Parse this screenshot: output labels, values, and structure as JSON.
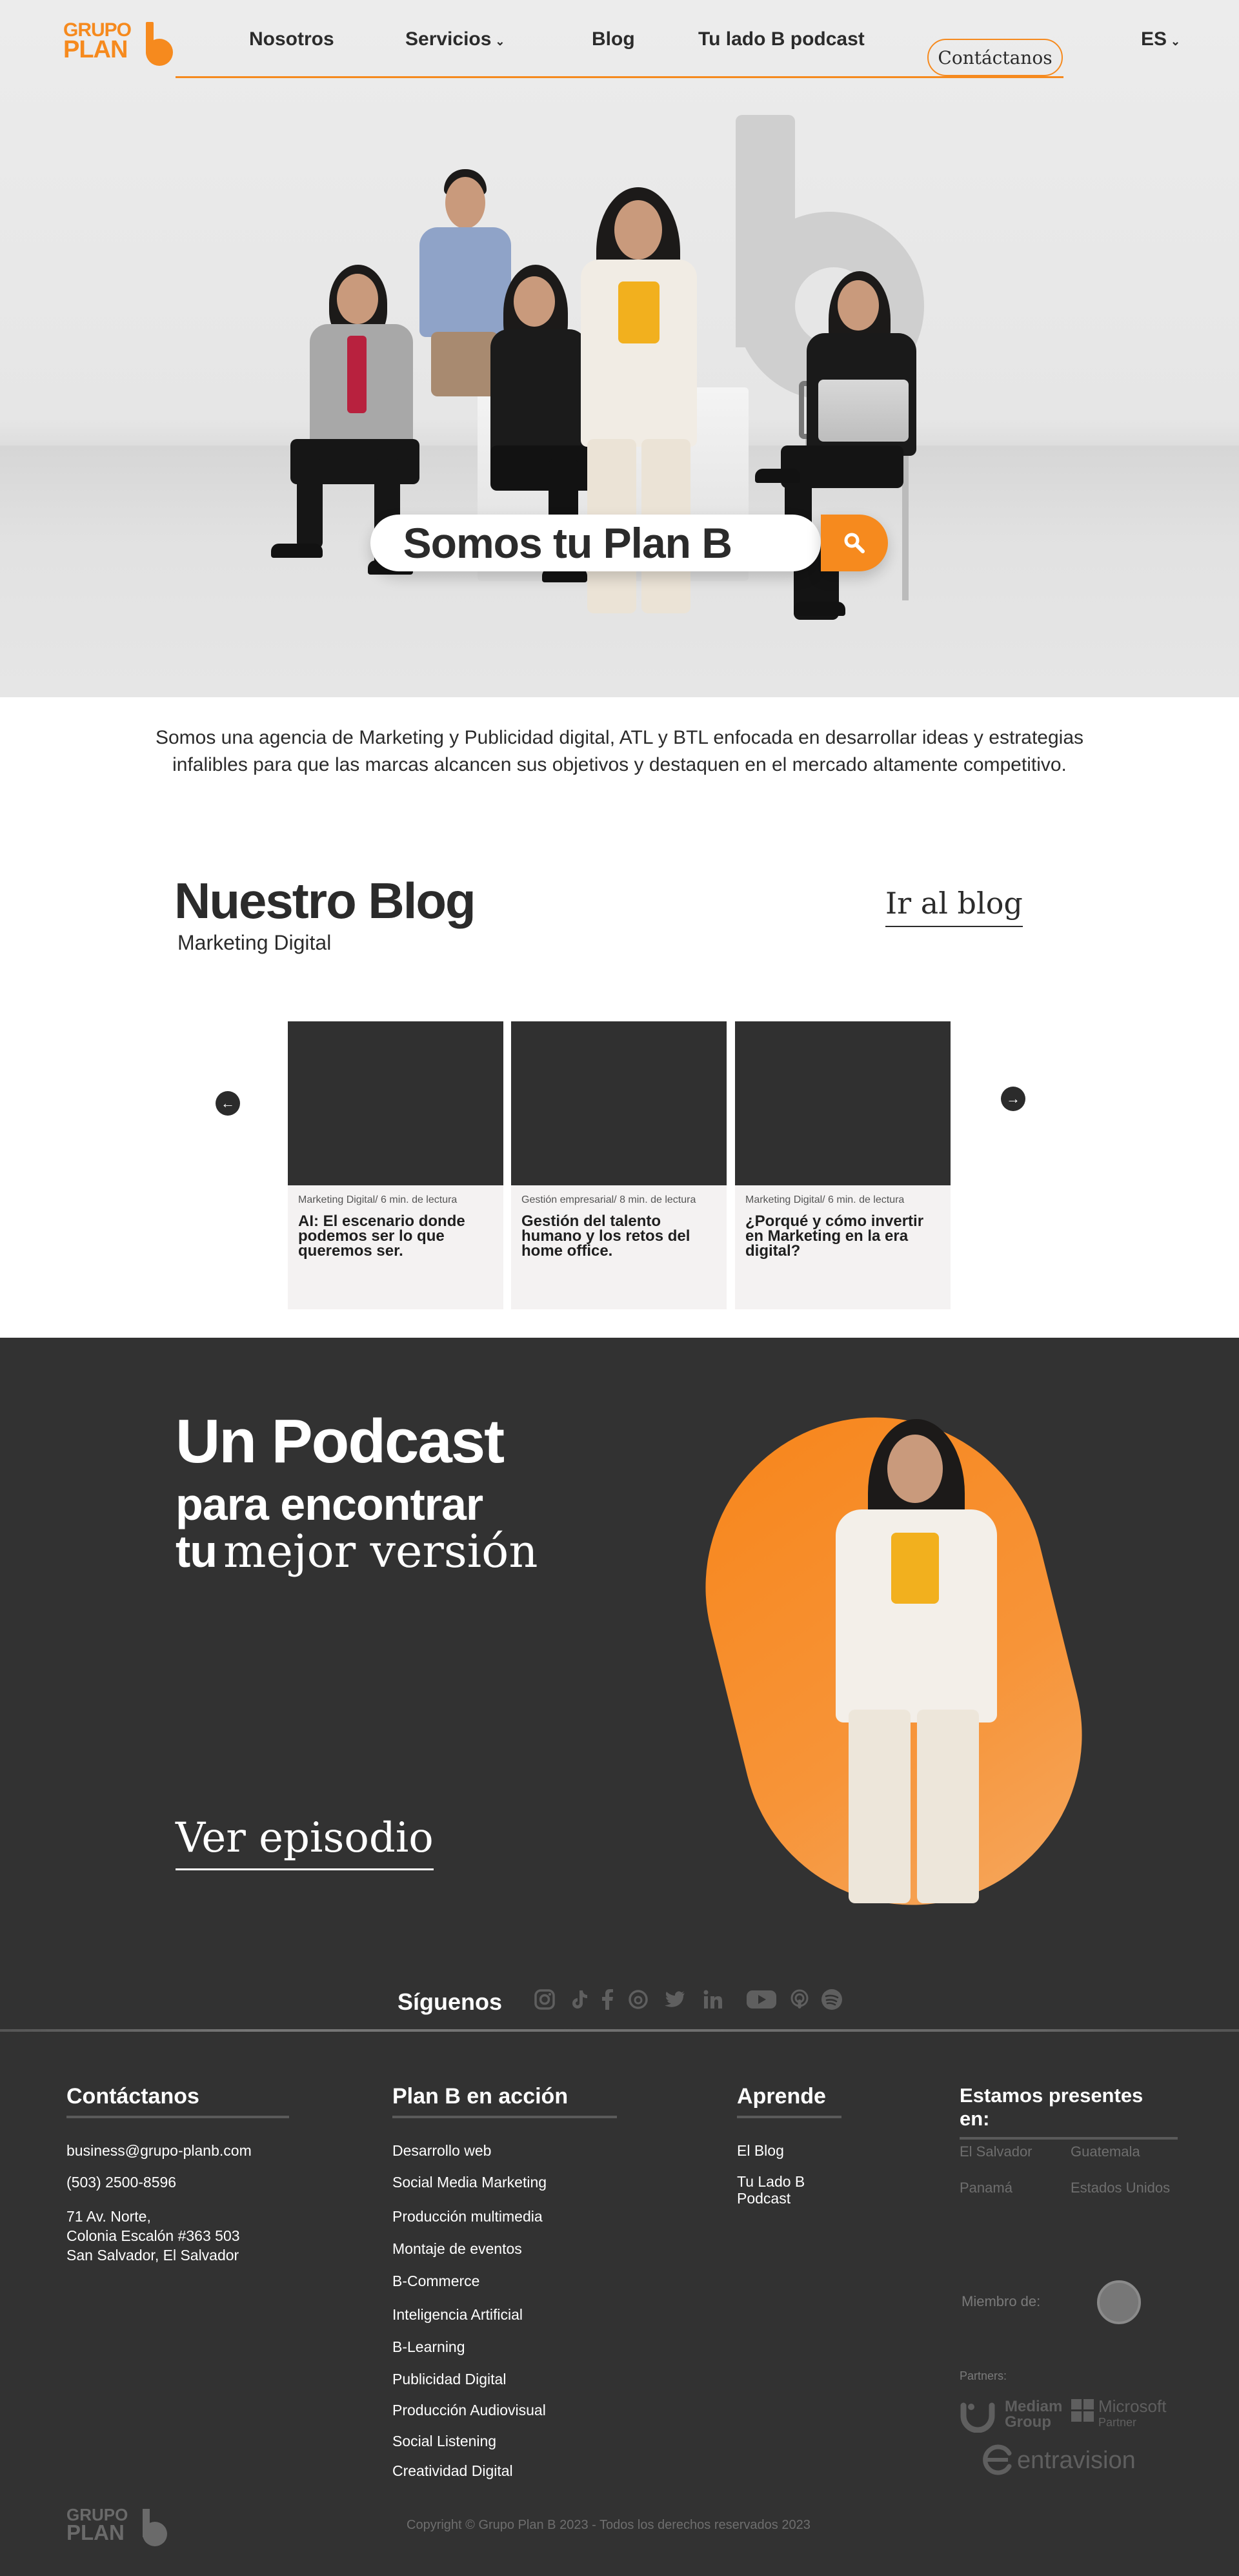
{
  "header": {
    "logo_text_top": "GRUPO",
    "logo_text_bottom": "PLAN",
    "nav": [
      {
        "label": "Nosotros"
      },
      {
        "label": "Servicios",
        "chevron": "chevron-down-icon"
      },
      {
        "label": "Blog"
      },
      {
        "label": "Tu lado B podcast"
      }
    ],
    "contact_label": "Contáctanos",
    "language": "ES"
  },
  "hero": {
    "search_text": "Somos tu Plan B",
    "search_icon": "search-icon"
  },
  "intro": {
    "text": "Somos una agencia de Marketing y Publicidad digital, ATL y BTL enfocada en desarrollar ideas y estrategias infalibles para que las marcas alcancen sus objetivos y destaquen en el mercado altamente competitivo."
  },
  "blog": {
    "title": "Nuestro Blog",
    "subtitle": "Marketing Digital",
    "link": "Ir al blog",
    "prev_icon": "arrow-left-icon",
    "next_icon": "arrow-right-icon",
    "cards": [
      {
        "meta": "Marketing Digital/ 6 min. de lectura",
        "title": "AI: El escenario donde podemos ser lo que queremos ser."
      },
      {
        "meta": "Gestión empresarial/ 8 min. de lectura",
        "title": "Gestión del talento humano y los retos del home office."
      },
      {
        "meta": "Marketing Digital/ 6 min. de lectura",
        "title": "¿Porqué y cómo invertir en Marketing en la era digital?"
      }
    ]
  },
  "podcast": {
    "line1": "Un Podcast",
    "line2": "para encontrar",
    "line3_bold": "tu",
    "line3_serif": "mejor versión",
    "link": "Ver episodio"
  },
  "footer": {
    "follow": "Síguenos",
    "social_icons": [
      "instagram-icon",
      "tiktok-icon",
      "facebook-icon",
      "threads-icon",
      "twitter-icon",
      "linkedin-icon",
      "youtube-icon",
      "podcast-icon",
      "spotify-icon"
    ],
    "contact": {
      "heading": "Contáctanos",
      "email": "business@grupo-planb.com",
      "phone": "(503) 2500-8596",
      "address1": "71 Av. Norte,",
      "address2": "Colonia Escalón #363 503",
      "address3": "San Salvador, El Salvador"
    },
    "services": {
      "heading": "Plan B en acción",
      "items": [
        "Desarrollo web",
        "Social Media Marketing",
        "Producción multimedia",
        "Montaje de eventos",
        "B-Commerce",
        "Inteligencia Artificial",
        "B-Learning",
        "Publicidad Digital",
        "Producción Audiovisual",
        "Social Listening",
        "Creatividad Digital"
      ]
    },
    "learn": {
      "heading": "Aprende",
      "items": [
        "El Blog",
        "Tu Lado B Podcast"
      ]
    },
    "presence": {
      "heading": "Estamos presentes en:",
      "countries": [
        "El Salvador",
        "Guatemala",
        "Panamá",
        "Estados Unidos"
      ],
      "member_label": "Miembro de:",
      "partners_label": "Partners:",
      "partner1_a": "Mediam",
      "partner1_b": "Group",
      "partner2_a": "Microsoft",
      "partner2_b": "Partner",
      "partner3": "entravision"
    },
    "logo_top": "GRUPO",
    "logo_bottom": "PLAN",
    "copyright": "Copyright © Grupo Plan B 2023 - Todos los derechos reservados 2023"
  },
  "colors": {
    "accent": "#f68a1e",
    "dark": "#323232",
    "text": "#2b2b2b"
  }
}
